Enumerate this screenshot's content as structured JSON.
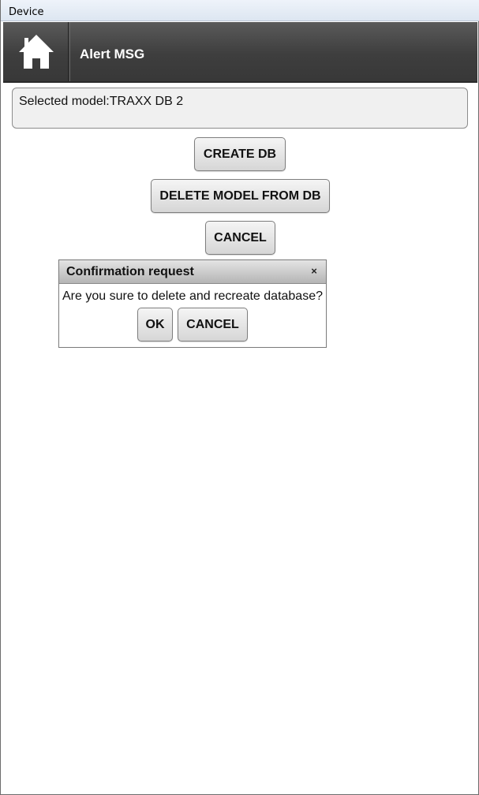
{
  "window": {
    "title": "Device"
  },
  "header": {
    "home_icon": "home-icon",
    "title": "Alert MSG"
  },
  "model": {
    "selected_text": "Selected model:TRAXX DB 2"
  },
  "actions": {
    "create_db_label": "CREATE DB",
    "delete_model_label": "DELETE MODEL FROM DB",
    "cancel_label": "CANCEL"
  },
  "dialog": {
    "title": "Confirmation request",
    "close_glyph": "×",
    "message": "Are you sure to delete and recreate database?",
    "ok_label": "OK",
    "cancel_label": "CANCEL"
  }
}
